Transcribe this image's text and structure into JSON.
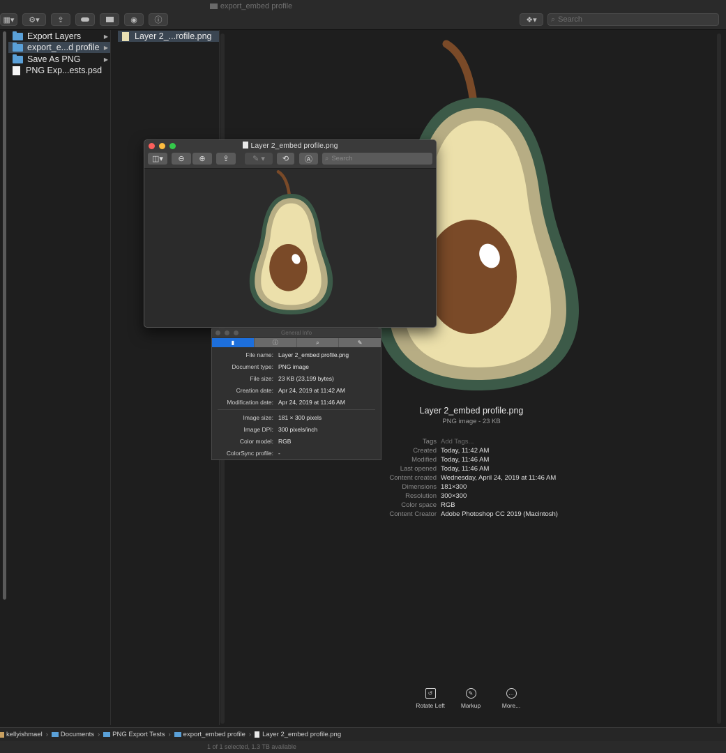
{
  "window": {
    "title": "export_embed profile"
  },
  "toolbar": {
    "search_placeholder": "Search"
  },
  "column1": {
    "items": [
      {
        "label": "Export Layers",
        "type": "folder"
      },
      {
        "label": "export_e...d profile",
        "type": "folder",
        "selected": true
      },
      {
        "label": "Save As PNG",
        "type": "folder"
      },
      {
        "label": "PNG Exp...ests.psd",
        "type": "file"
      }
    ]
  },
  "column2": {
    "items": [
      {
        "label": "Layer 2_...rofile.png",
        "selected": true
      }
    ]
  },
  "preview": {
    "file_name": "Layer 2_embed profile.png",
    "file_kind": "PNG image - 23 KB",
    "metadata": [
      {
        "key": "Tags",
        "value": "Add Tags..."
      },
      {
        "key": "Created",
        "value": "Today, 11:42 AM"
      },
      {
        "key": "Modified",
        "value": "Today, 11:46 AM"
      },
      {
        "key": "Last opened",
        "value": "Today, 11:46 AM"
      },
      {
        "key": "Content created",
        "value": "Wednesday, April 24, 2019 at 11:46 AM"
      },
      {
        "key": "Dimensions",
        "value": "181×300"
      },
      {
        "key": "Resolution",
        "value": "300×300"
      },
      {
        "key": "Color space",
        "value": "RGB"
      },
      {
        "key": "Content Creator",
        "value": "Adobe Photoshop CC 2019 (Macintosh)"
      }
    ],
    "actions": [
      {
        "label": "Rotate Left",
        "icon": "rotate-left-icon"
      },
      {
        "label": "Markup",
        "icon": "markup-icon"
      },
      {
        "label": "More...",
        "icon": "more-icon"
      }
    ]
  },
  "preview_window": {
    "title": "Layer 2_embed profile.png",
    "search_placeholder": "Search"
  },
  "info_panel": {
    "title": "General Info",
    "general": [
      {
        "key": "File name:",
        "value": "Layer 2_embed profile.png"
      },
      {
        "key": "Document type:",
        "value": "PNG image"
      },
      {
        "key": "File size:",
        "value": "23 KB (23,199 bytes)"
      },
      {
        "key": "Creation date:",
        "value": "Apr 24, 2019 at 11:42 AM"
      },
      {
        "key": "Modification date:",
        "value": "Apr 24, 2019 at 11:46 AM"
      }
    ],
    "image": [
      {
        "key": "Image size:",
        "value": "181 × 300 pixels"
      },
      {
        "key": "Image DPI:",
        "value": "300 pixels/inch"
      },
      {
        "key": "Color model:",
        "value": "RGB"
      },
      {
        "key": "ColorSync profile:",
        "value": "-"
      }
    ]
  },
  "pathbar": {
    "crumbs": [
      "kellyishmael",
      "Documents",
      "PNG Export Tests",
      "export_embed profile",
      "Layer 2_embed profile.png"
    ]
  },
  "status": {
    "text": "1 of 1 selected, 1.3 TB available"
  },
  "colors": {
    "avocado_skin": "#3c5a48",
    "avocado_rim": "#b7ad84",
    "avocado_flesh": "#ece0ab",
    "avocado_pit": "#7a4a28",
    "stem": "#7a4a28",
    "selection": "#3b4652",
    "accent_tab": "#1d6fdc"
  }
}
